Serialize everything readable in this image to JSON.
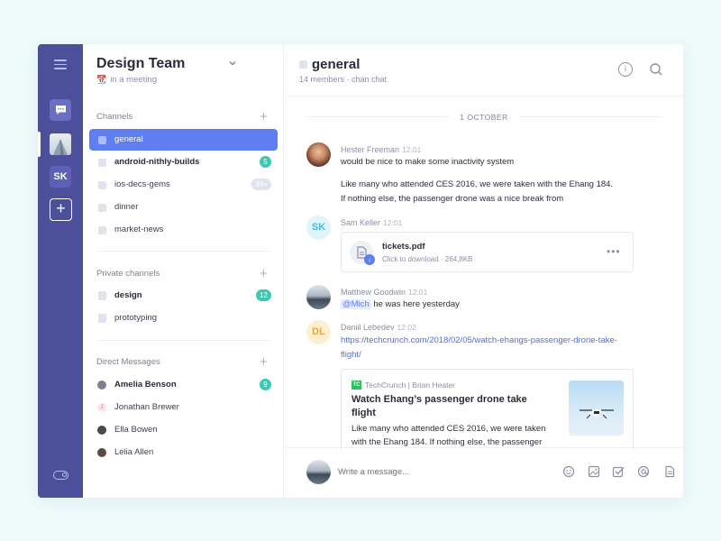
{
  "rail": {
    "workspace_initials": "SK",
    "add_label": "+"
  },
  "sidebar": {
    "team_name": "Design Team",
    "status_emoji": "📆",
    "status_text": "in a meeting",
    "channels_title": "Channels",
    "channels": [
      {
        "label": "general",
        "active": true,
        "bold": false,
        "badge": ""
      },
      {
        "label": "android-nithly-builds",
        "active": false,
        "bold": true,
        "badge": "5"
      },
      {
        "label": "ios-decs-gems",
        "active": false,
        "bold": false,
        "badge": "99+"
      },
      {
        "label": "dinner",
        "active": false,
        "bold": false,
        "badge": ""
      },
      {
        "label": "market-news",
        "active": false,
        "bold": false,
        "badge": ""
      }
    ],
    "private_title": "Private channels",
    "private_channels": [
      {
        "label": "design",
        "bold": true,
        "badge": "12"
      },
      {
        "label": "prototyping",
        "bold": false,
        "badge": ""
      }
    ],
    "dm_title": "Direct Messages",
    "direct_messages": [
      {
        "label": "Amelia Benson",
        "bold": true,
        "badge": "9",
        "avatar_color": "#7d8090"
      },
      {
        "label": "Jonathan Brewer",
        "bold": false,
        "badge": "",
        "avatar_initial": "J",
        "avatar_color": "#fbe3ea"
      },
      {
        "label": "Ella Bowen",
        "bold": false,
        "badge": "",
        "avatar_color": "#4a4a4a"
      },
      {
        "label": "Lelia Allen",
        "bold": false,
        "badge": "",
        "avatar_color": "#5a4a40"
      }
    ]
  },
  "header": {
    "channel": "general",
    "subtitle": "14 members · chan chat"
  },
  "date_separator": "1 OCTOBER",
  "messages": [
    {
      "author": "Hester Freeman",
      "time": "12:01",
      "lines": [
        "would be nice to make some inactivity system",
        "Like many who attended CES 2016, we were taken with the Ehang 184.",
        "If nothing else, the passenger drone was a nice break from"
      ]
    },
    {
      "author": "Sam Keller",
      "time": "12:01",
      "initials": "SK",
      "file": {
        "name": "tickets.pdf",
        "sub": "Click to download · 264,8KB",
        "more": "•••"
      }
    },
    {
      "author": "Matthew Goodwin",
      "time": "12:01",
      "mention": "@Mich",
      "text": " he was here yesterday"
    },
    {
      "author": "Daniil Lebedev",
      "time": "12:02",
      "initials": "DL",
      "link_line1": "https://techcrunch.com/2018/02/05/watch-ehangs-passenger-drone-take-",
      "link_line2": "flight/",
      "preview": {
        "source_logo": "TC",
        "source": "TechCrunch | Brian Heater",
        "title": "Watch Ehang’s passenger drone take flight",
        "description": "Like many who attended CES 2016, we were taken with the Ehang 184. If nothing else, the passenger"
      }
    }
  ],
  "composer": {
    "placeholder": "Write a message..."
  },
  "toolbar": {
    "more": "•••"
  },
  "colors": {
    "rail": "#4c4f99",
    "accent": "#5e7ef2",
    "badge": "#3ec7b2"
  }
}
